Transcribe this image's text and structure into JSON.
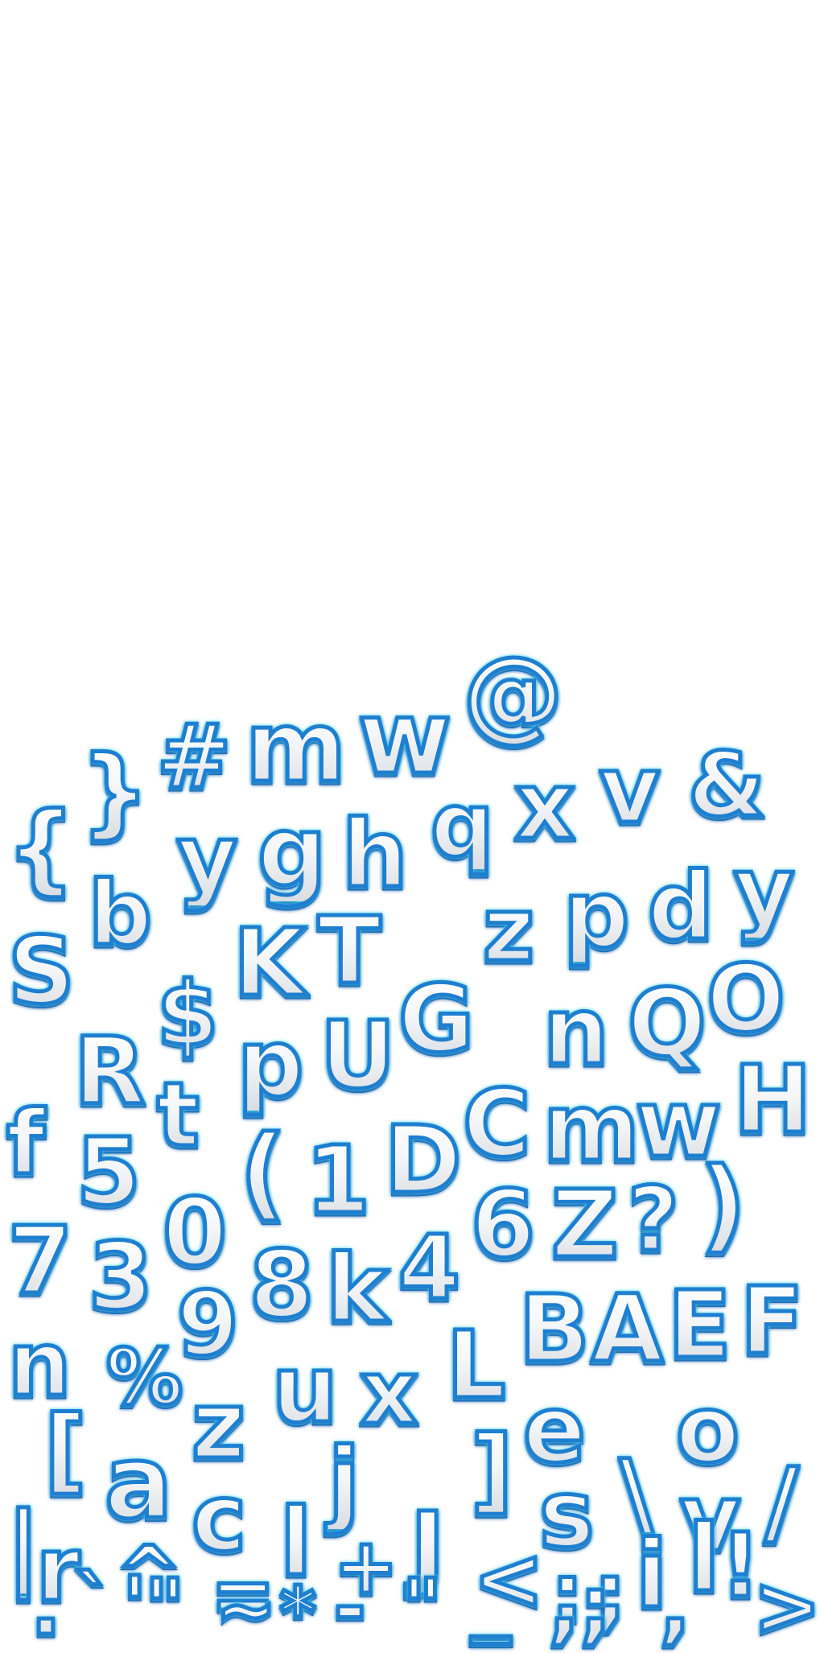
{
  "sheet": {
    "title": "",
    "glyph_fill_top": "#ffffff",
    "glyph_fill_bottom": "#d9dde1",
    "glyph_outline": "#1e7fd0",
    "glyph_glow": "#3fd8f2",
    "glyph_shadow": "#1e5fae",
    "background": "#ffffff"
  },
  "glyphs": [
    {
      "name": "glyph-at",
      "char": "@"
    },
    {
      "name": "glyph-w",
      "char": "w"
    },
    {
      "name": "glyph-m",
      "char": "m"
    },
    {
      "name": "glyph-hash",
      "char": "#"
    },
    {
      "name": "glyph-close-brace",
      "char": "}"
    },
    {
      "name": "glyph-open-brace",
      "char": "{"
    },
    {
      "name": "glyph-x",
      "char": "x"
    },
    {
      "name": "glyph-v",
      "char": "v"
    },
    {
      "name": "glyph-ampersand",
      "char": "&"
    },
    {
      "name": "glyph-y",
      "char": "y"
    },
    {
      "name": "glyph-g",
      "char": "g"
    },
    {
      "name": "glyph-h",
      "char": "h"
    },
    {
      "name": "glyph-q",
      "char": "q"
    },
    {
      "name": "glyph-b",
      "char": "b"
    },
    {
      "name": "glyph-z-1",
      "char": "z"
    },
    {
      "name": "glyph-p-1",
      "char": "p"
    },
    {
      "name": "glyph-d",
      "char": "d"
    },
    {
      "name": "glyph-y-2",
      "char": "y"
    },
    {
      "name": "glyph-s-1",
      "char": "S"
    },
    {
      "name": "glyph-k-1",
      "char": "K"
    },
    {
      "name": "glyph-t-1",
      "char": "T"
    },
    {
      "name": "glyph-g-2",
      "char": "G"
    },
    {
      "name": "glyph-o-1",
      "char": "O"
    },
    {
      "name": "glyph-dollar",
      "char": "$"
    },
    {
      "name": "glyph-n-1",
      "char": "n"
    },
    {
      "name": "glyph-q-2",
      "char": "Q"
    },
    {
      "name": "glyph-r-1",
      "char": "R"
    },
    {
      "name": "glyph-p-2",
      "char": "p"
    },
    {
      "name": "glyph-u-1",
      "char": "U"
    },
    {
      "name": "glyph-c-1",
      "char": "C"
    },
    {
      "name": "glyph-m-2",
      "char": "m"
    },
    {
      "name": "glyph-w-2",
      "char": "w"
    },
    {
      "name": "glyph-h-2",
      "char": "H"
    },
    {
      "name": "glyph-t-2",
      "char": "t"
    },
    {
      "name": "glyph-f-1",
      "char": "f"
    },
    {
      "name": "glyph-5",
      "char": "5"
    },
    {
      "name": "glyph-open-paren",
      "char": "("
    },
    {
      "name": "glyph-1",
      "char": "1"
    },
    {
      "name": "glyph-d-2",
      "char": "D"
    },
    {
      "name": "glyph-0",
      "char": "0"
    },
    {
      "name": "glyph-6",
      "char": "6"
    },
    {
      "name": "glyph-z-2",
      "char": "Z"
    },
    {
      "name": "glyph-question",
      "char": "?"
    },
    {
      "name": "glyph-close-paren",
      "char": ")"
    },
    {
      "name": "glyph-7",
      "char": "7"
    },
    {
      "name": "glyph-3",
      "char": "3"
    },
    {
      "name": "glyph-8",
      "char": "8"
    },
    {
      "name": "glyph-k-2",
      "char": "k"
    },
    {
      "name": "glyph-4",
      "char": "4"
    },
    {
      "name": "glyph-9",
      "char": "9"
    },
    {
      "name": "glyph-b-2",
      "char": "B"
    },
    {
      "name": "glyph-a-1",
      "char": "A"
    },
    {
      "name": "glyph-e-1",
      "char": "E"
    },
    {
      "name": "glyph-f-2",
      "char": "F"
    },
    {
      "name": "glyph-n-2",
      "char": "n"
    },
    {
      "name": "glyph-percent",
      "char": "%"
    },
    {
      "name": "glyph-u-2",
      "char": "u"
    },
    {
      "name": "glyph-x-2",
      "char": "x"
    },
    {
      "name": "glyph-l-1",
      "char": "L"
    },
    {
      "name": "glyph-z-3",
      "char": "z"
    },
    {
      "name": "glyph-e-2",
      "char": "e"
    },
    {
      "name": "glyph-o-2",
      "char": "o"
    },
    {
      "name": "glyph-open-bracket",
      "char": "["
    },
    {
      "name": "glyph-a-2",
      "char": "a"
    },
    {
      "name": "glyph-c-2",
      "char": "c"
    },
    {
      "name": "glyph-j-1",
      "char": "j"
    },
    {
      "name": "glyph-close-bracket",
      "char": "]"
    },
    {
      "name": "glyph-s-2",
      "char": "s"
    },
    {
      "name": "glyph-backslash",
      "char": "\\"
    },
    {
      "name": "glyph-v-2",
      "char": "v"
    },
    {
      "name": "glyph-slash",
      "char": "/"
    },
    {
      "name": "glyph-pipe",
      "char": "|"
    },
    {
      "name": "glyph-r-2",
      "char": "r"
    },
    {
      "name": "glyph-caret",
      "char": "^"
    },
    {
      "name": "glyph-equals",
      "char": "="
    },
    {
      "name": "glyph-l-2",
      "char": "l"
    },
    {
      "name": "glyph-plus",
      "char": "+"
    },
    {
      "name": "glyph-j-2",
      "char": "J"
    },
    {
      "name": "glyph-less-than",
      "char": "<"
    },
    {
      "name": "glyph-colon",
      "char": ":"
    },
    {
      "name": "glyph-semicolon",
      "char": ";"
    },
    {
      "name": "glyph-i",
      "char": "i"
    },
    {
      "name": "glyph-l-3",
      "char": "l"
    },
    {
      "name": "glyph-exclamation",
      "char": "!"
    },
    {
      "name": "glyph-greater-than",
      "char": ">"
    },
    {
      "name": "glyph-period",
      "char": "."
    },
    {
      "name": "glyph-backtick",
      "char": "`"
    },
    {
      "name": "glyph-apostrophe",
      "char": "'"
    },
    {
      "name": "glyph-double-quote",
      "char": "\""
    },
    {
      "name": "glyph-tilde",
      "char": "~"
    },
    {
      "name": "glyph-asterisk",
      "char": "*"
    },
    {
      "name": "glyph-minus",
      "char": "-"
    },
    {
      "name": "glyph-double-quote-2",
      "char": "\""
    },
    {
      "name": "glyph-underscore",
      "char": "_"
    },
    {
      "name": "glyph-comma",
      "char": ","
    },
    {
      "name": "glyph-semicolon-2",
      "char": ";"
    },
    {
      "name": "glyph-comma-2",
      "char": ","
    }
  ]
}
